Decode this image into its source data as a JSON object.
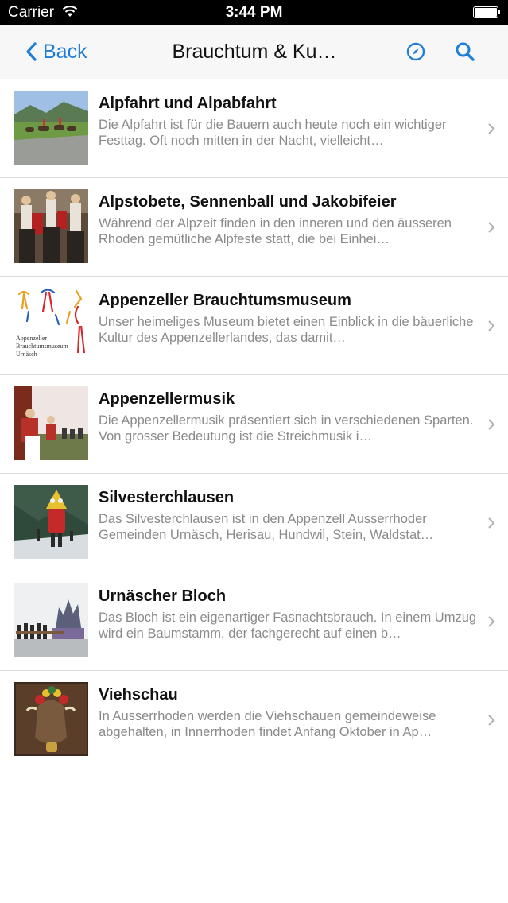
{
  "status_bar": {
    "carrier": "Carrier",
    "time": "3:44 PM"
  },
  "nav": {
    "back_label": "Back",
    "title": "Brauchtum & Ku…",
    "accent": "#1e7ed8"
  },
  "items": [
    {
      "title": "Alpfahrt und Alpabfahrt",
      "description": "Die Alpfahrt ist für die Bauern auch heute noch ein wichtiger Festtag. Oft noch mitten in der Nacht, vielleicht…",
      "image": "alpfahrt-photo"
    },
    {
      "title": "Alpstobete, Sennenball und Jakobifeier",
      "description": "Während der Alpzeit finden in den inneren und den äusseren Rhoden gemütliche Alpfeste statt, die bei Einhei…",
      "image": "alpstobete-photo"
    },
    {
      "title": "Appenzeller Brauchtumsmuseum",
      "description": "Unser heimeliges Museum bietet einen Einblick in die bäuerliche Kultur des Appenzellerlandes, das damit…",
      "image": "museum-logo",
      "logo_text": [
        "Appenzeller",
        "Brauchtumsmuseum",
        "Urnäsch"
      ]
    },
    {
      "title": "Appenzellermusik",
      "description": "Die Appenzellermusik präsentiert sich in verschiedenen Sparten. Von grosser Bedeutung ist die Streichmusik i…",
      "image": "appenzellermusik-photo"
    },
    {
      "title": "Silvesterchlausen",
      "description": "Das Silvesterchlausen ist in den Appenzell Ausserrhoder Gemeinden Urnäsch, Herisau, Hundwil, Stein, Waldstat…",
      "image": "silvesterchlausen-photo"
    },
    {
      "title": "Urnäscher Bloch",
      "description": "Das Bloch ist ein eigenartiger Fasnachtsbrauch. In einem Umzug wird ein Baumstamm, der fachgerecht auf einen b…",
      "image": "bloch-photo"
    },
    {
      "title": "Viehschau",
      "description": "In Ausserrhoden werden die Viehschauen gemeindeweise abgehalten, in Innerrhoden findet Anfang Oktober in Ap…",
      "image": "viehschau-photo"
    }
  ]
}
